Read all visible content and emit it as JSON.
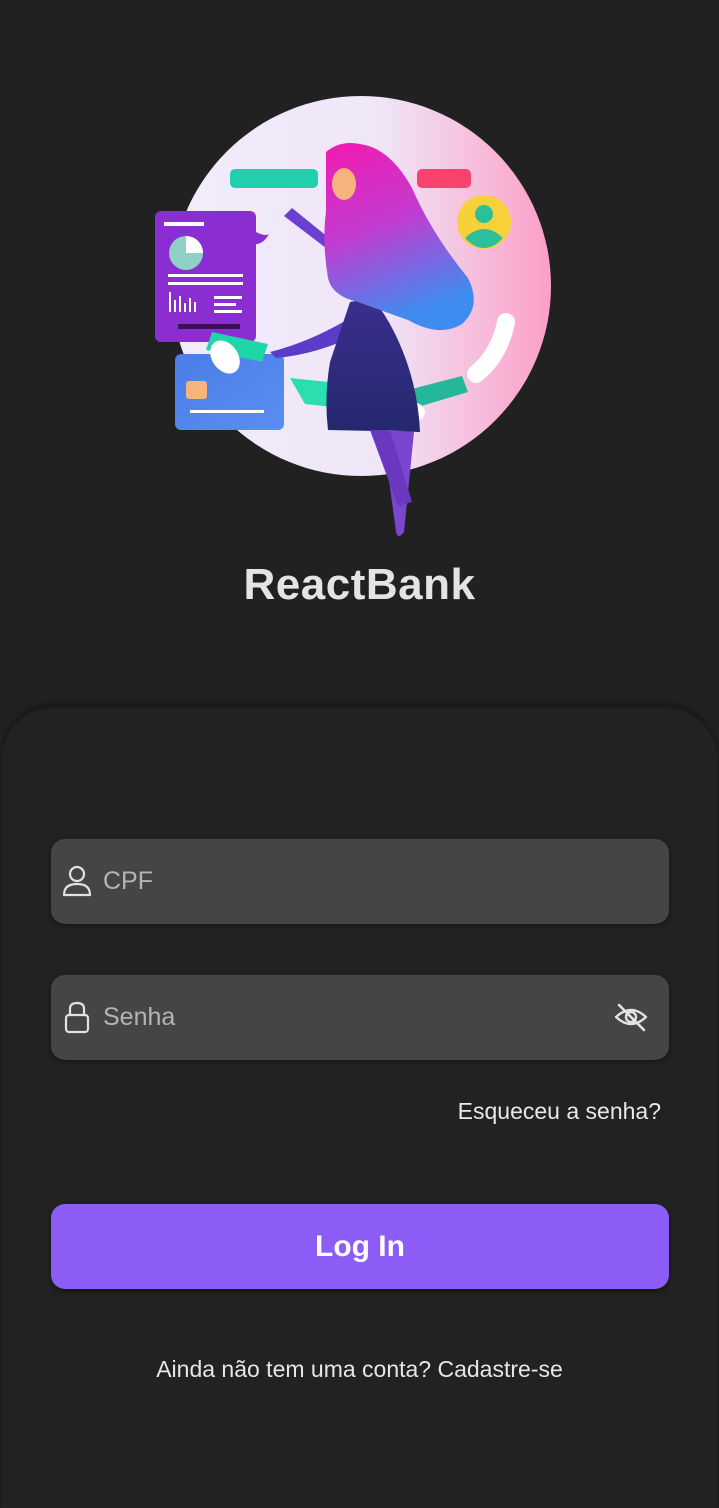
{
  "app": {
    "title": "ReactBank"
  },
  "hero": {
    "illustration": "woman-juggling-finance-icons-illustration"
  },
  "form": {
    "cpf": {
      "placeholder": "CPF",
      "value": "",
      "icon": "user-icon"
    },
    "password": {
      "placeholder": "Senha",
      "value": "",
      "icon": "lock-icon",
      "toggle_icon": "eye-off-icon"
    },
    "forgot_label": "Esqueceu a senha?",
    "login_label": "Log In",
    "signup_label": "Ainda não tem uma conta? Cadastre-se"
  },
  "colors": {
    "background": "#212121",
    "field": "#454545",
    "accent": "#8C5CF6",
    "text": "#E6E6E6",
    "placeholder": "#B4B4B4"
  }
}
